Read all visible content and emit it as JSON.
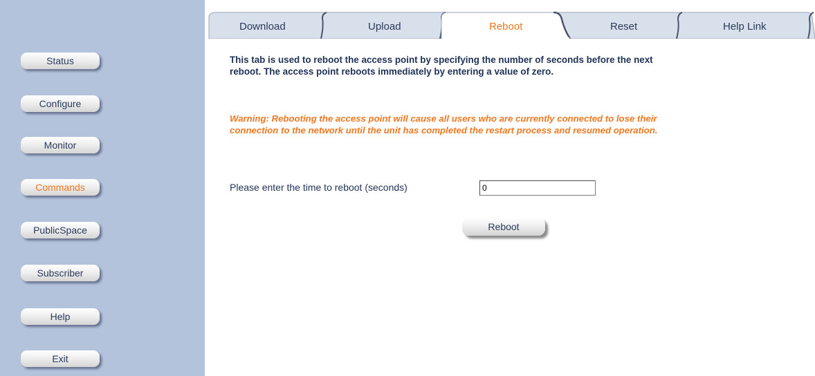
{
  "sidebar": {
    "items": [
      {
        "label": "Status",
        "active": false
      },
      {
        "label": "Configure",
        "active": false
      },
      {
        "label": "Monitor",
        "active": false
      },
      {
        "label": "Commands",
        "active": true
      },
      {
        "label": "PublicSpace",
        "active": false
      },
      {
        "label": "Subscriber",
        "active": false
      },
      {
        "label": "Help",
        "active": false
      },
      {
        "label": "Exit",
        "active": false
      }
    ]
  },
  "tabs": [
    {
      "label": "Download",
      "active": false
    },
    {
      "label": "Upload",
      "active": false
    },
    {
      "label": "Reboot",
      "active": true
    },
    {
      "label": "Reset",
      "active": false
    },
    {
      "label": "Help Link",
      "active": false
    }
  ],
  "main": {
    "intro_text": "This tab is used to reboot the access point by specifying the number of seconds before the next reboot. The access point reboots immediately by entering a value of zero.",
    "warning_text": "Warning: Rebooting the access point will cause all users who are currently connected to lose their connection to the network until the unit has completed the restart process and resumed operation.",
    "reboot_time_label": "Please enter the time to reboot (seconds)",
    "reboot_time_value": "0",
    "reboot_button_label": "Reboot"
  },
  "colors": {
    "sidebar_bg": "#b4c3dc",
    "tab_bg": "#d8e0ec",
    "active_accent": "#f07820",
    "text_dark": "#1f3256"
  }
}
